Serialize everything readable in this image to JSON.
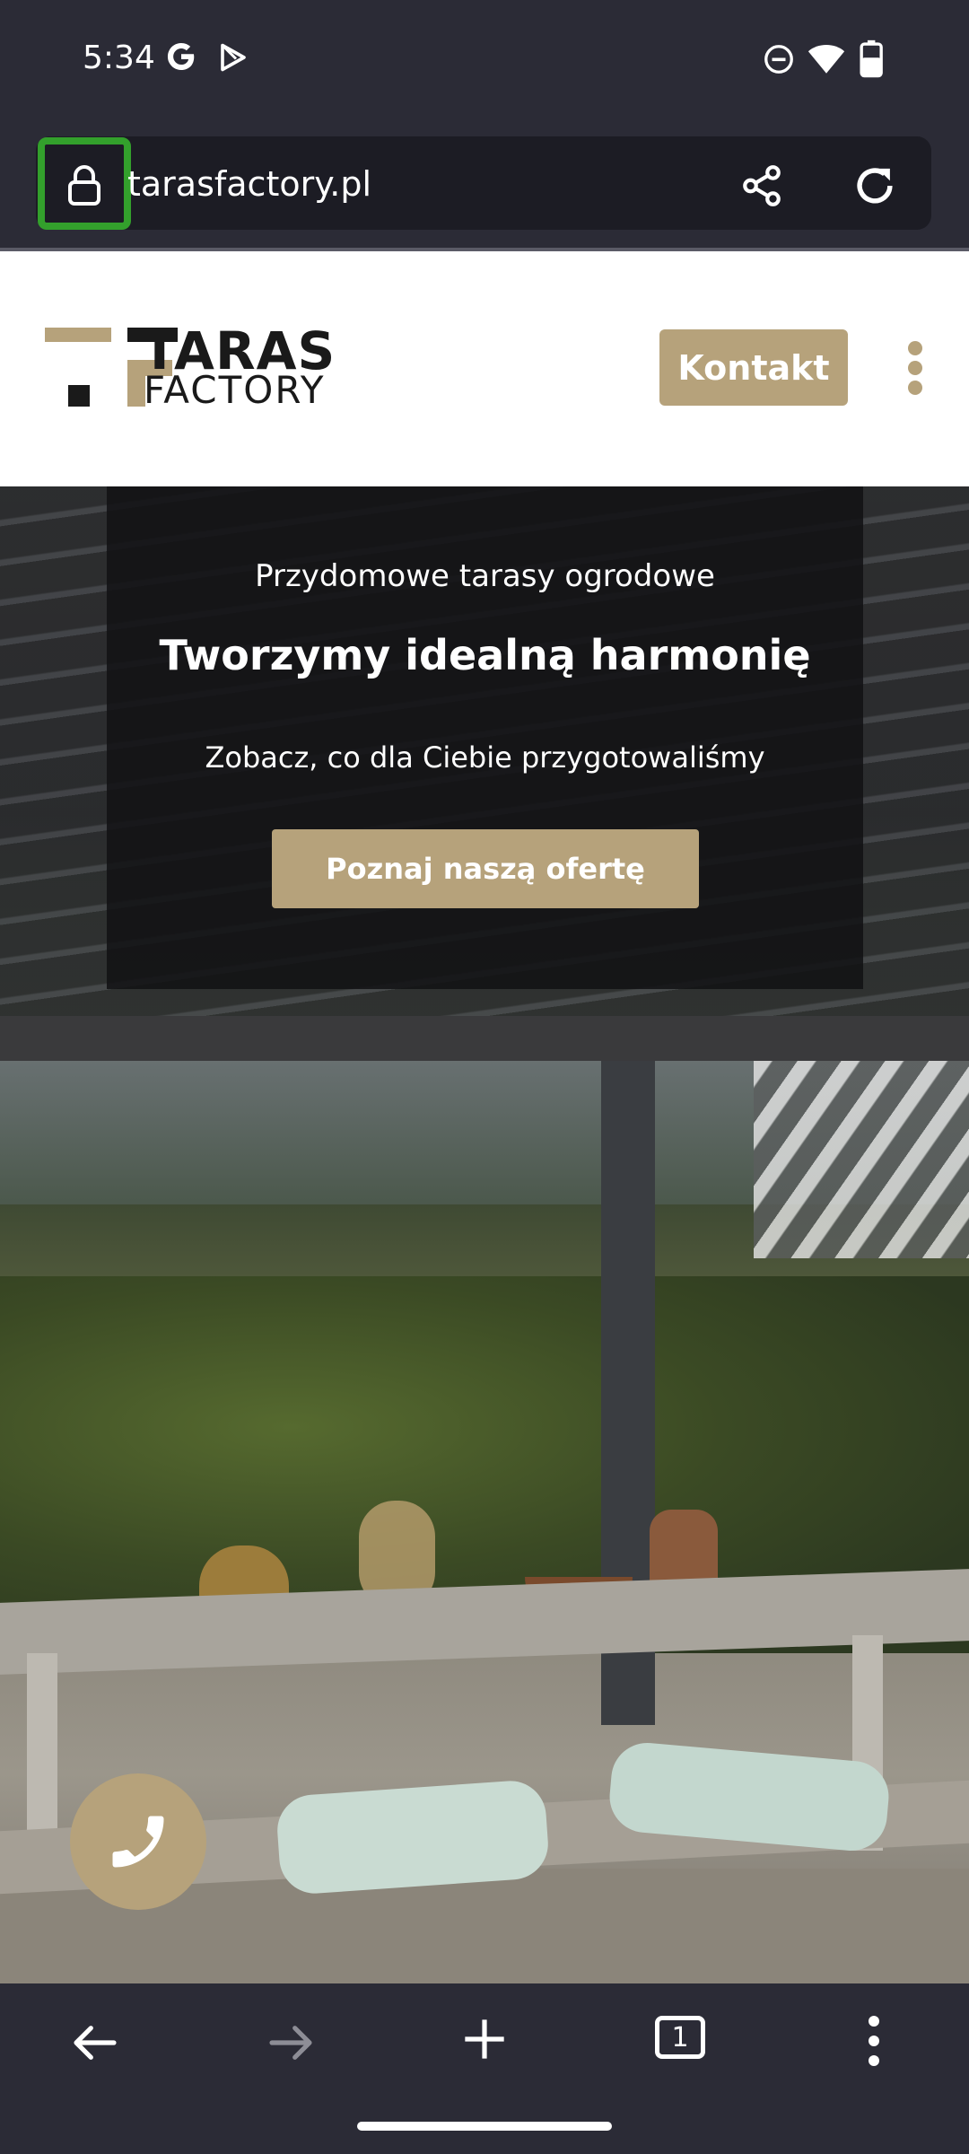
{
  "status_bar": {
    "time": "5:34",
    "icons": [
      "google-icon",
      "play-store-icon",
      "do-not-disturb-icon",
      "wifi-icon",
      "battery-icon"
    ]
  },
  "browser": {
    "url": "tarasfactory.pl",
    "icons": [
      "lock-icon",
      "share-icon",
      "reload-icon"
    ],
    "highlight_color": "#33a02c"
  },
  "site": {
    "logo": {
      "line1": "TARAS",
      "line2": "FACTORY"
    },
    "contact_label": "Kontakt",
    "accent_color": "#b6a27b"
  },
  "hero": {
    "eyebrow": "Przydomowe tarasy ogrodowe",
    "title": "Tworzymy idealną harmonię",
    "subtitle": "Zobacz, co dla Ciebie przygotowaliśmy",
    "cta_label": "Poznaj naszą ofertę"
  },
  "bottom_nav": {
    "tab_count": "1",
    "icons": [
      "back-icon",
      "forward-icon",
      "new-tab-icon",
      "tabs-icon",
      "menu-icon"
    ]
  }
}
